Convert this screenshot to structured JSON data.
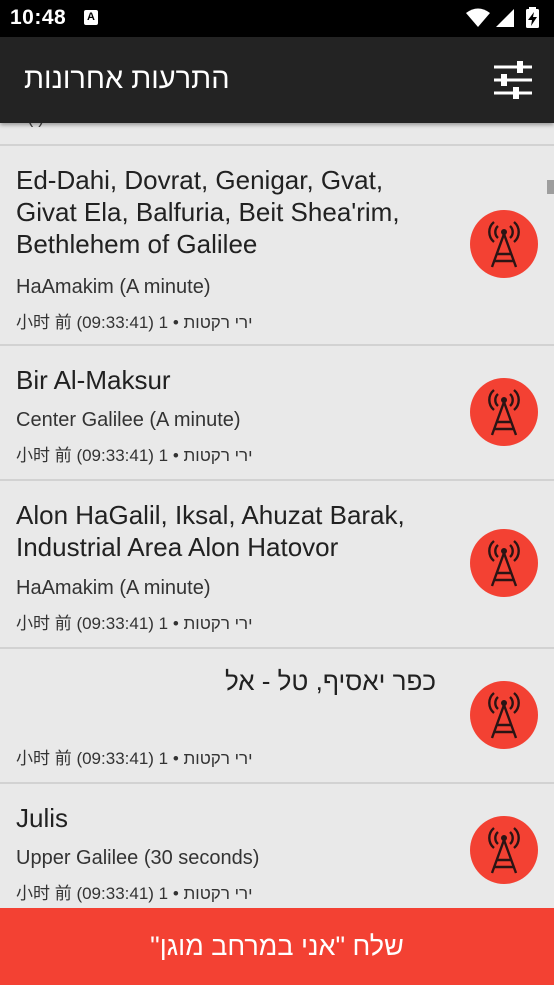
{
  "status_bar": {
    "time": "10:48",
    "notification_glyph": "A",
    "icons": [
      "wifi-icon",
      "cell-signal-icon",
      "battery-charging-icon"
    ]
  },
  "app_bar": {
    "title": "התרעות אחרונות",
    "filter_icon": "sliders-icon"
  },
  "list": {
    "partial_top_text": "•  (   )",
    "alerts": [
      {
        "cities": "Ed-Dahi, Dovrat, Genigar, Gvat, Givat Ela, Balfuria, Beit Shea'rim, Bethlehem of Galilee",
        "zone": "HaAmakim (A minute)",
        "time": "小时 前 (09:33:41) 1 • ירי רקטות",
        "rtl": false
      },
      {
        "cities": "Bir Al-Maksur",
        "zone": "Center Galilee (A minute)",
        "time": "小时 前 (09:33:41) 1 • ירי רקטות",
        "rtl": false
      },
      {
        "cities": "Alon HaGalil, Iksal, Ahuzat Barak, Industrial Area Alon Hatovor",
        "zone": "HaAmakim (A minute)",
        "time": "小时 前 (09:33:41) 1 • ירי רקטות",
        "rtl": false
      },
      {
        "cities": "כפר יאסיף, טל - אל",
        "zone": "",
        "time": "小时 前 (09:33:41) 1 • ירי רקטות",
        "rtl": true
      },
      {
        "cities": "Julis",
        "zone": "Upper Galilee (30 seconds)",
        "time": "小时 前 (09:33:41) 1 • ירי רקטות",
        "rtl": false
      }
    ],
    "alert_icon": "radio-tower-icon"
  },
  "bottom_button": {
    "label": "שלח \"אני במרחב מוגן\""
  },
  "colors": {
    "accent_red": "#f34133",
    "app_bar": "#232323",
    "background": "#e9e9e9"
  }
}
